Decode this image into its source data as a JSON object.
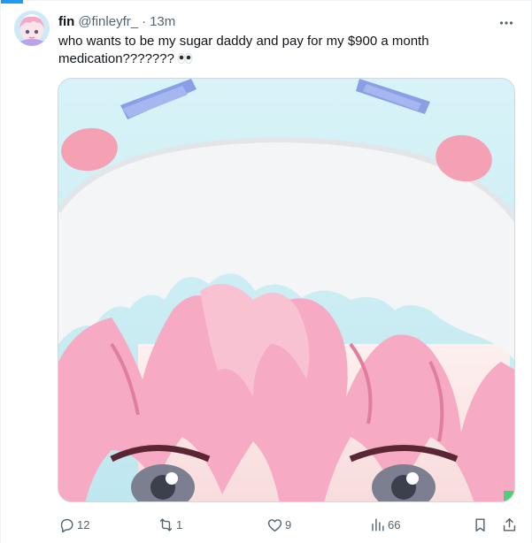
{
  "tweet": {
    "author": {
      "display_name": "fin",
      "handle": "@finleyfr_",
      "separator": "·",
      "time": "13m",
      "avatar_icon": "avatar-image"
    },
    "text": "who wants to be my sugar daddy and pay for my $900 a month medication???????",
    "emoji": "eyes-emoji",
    "media": {
      "kind": "image",
      "description_icon": "anime-character-image"
    },
    "actions": {
      "reply_count": "12",
      "retweet_count": "1",
      "like_count": "9",
      "views_count": "66"
    },
    "icons": {
      "more": "more-horizontal-icon",
      "reply": "reply-icon",
      "retweet": "retweet-icon",
      "like": "heart-icon",
      "views": "analytics-icon",
      "bookmark": "bookmark-icon",
      "share": "share-icon"
    },
    "colors": {
      "accent": "#1d9bf0",
      "text_primary": "#0f1419",
      "text_secondary": "#536471",
      "border": "#cfd9de"
    }
  }
}
